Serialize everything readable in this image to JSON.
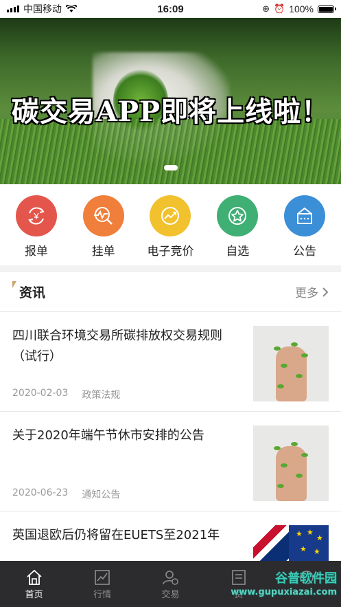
{
  "status_bar": {
    "carrier": "中国移动",
    "time": "16:09",
    "battery": "100%"
  },
  "banner": {
    "title": "碳交易APP即将上线啦！"
  },
  "actions": [
    {
      "label": "报单",
      "color": "#e4564c",
      "icon": "yen-cycle-icon"
    },
    {
      "label": "挂单",
      "color": "#ef7f3a",
      "icon": "chart-search-icon"
    },
    {
      "label": "电子竞价",
      "color": "#f2c12e",
      "icon": "trend-icon"
    },
    {
      "label": "自选",
      "color": "#3faf73",
      "icon": "star-icon"
    },
    {
      "label": "公告",
      "color": "#3b8fd7",
      "icon": "announcement-icon"
    }
  ],
  "news": {
    "section_title": "资讯",
    "more_label": "更多",
    "items": [
      {
        "title": "四川联合环境交易所碳排放权交易规则（试行）",
        "date": "2020-02-03",
        "category": "政策法规"
      },
      {
        "title": "关于2020年端午节休市安排的公告",
        "date": "2020-06-23",
        "category": "通知公告"
      },
      {
        "title": "英国退欧后仍将留在EUETS至2021年",
        "date": "",
        "category": ""
      }
    ]
  },
  "tabbar": {
    "tabs": [
      {
        "label": "首页"
      },
      {
        "label": "行情"
      },
      {
        "label": "交易"
      },
      {
        "label": "资"
      }
    ]
  },
  "watermark": {
    "name": "谷普软件园",
    "url": "www.gupuxiazai.com"
  }
}
